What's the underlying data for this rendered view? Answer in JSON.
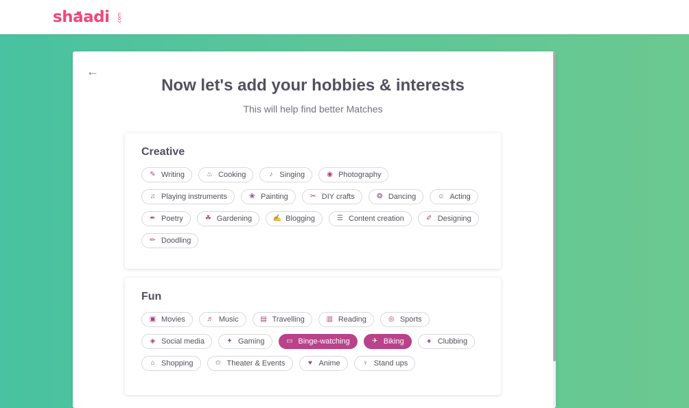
{
  "header": {
    "logo_text": "shaadi",
    "logo_suffix": ".com"
  },
  "page": {
    "title": "Now let's add your hobbies & interests",
    "subtitle": "This will help find better Matches"
  },
  "sections": [
    {
      "title": "Creative",
      "items": [
        {
          "label": "Writing",
          "icon": "writing-icon",
          "glyph": "✎",
          "selected": false
        },
        {
          "label": "Cooking",
          "icon": "cooking-icon",
          "glyph": "♨",
          "selected": false
        },
        {
          "label": "Singing",
          "icon": "singing-icon",
          "glyph": "♪",
          "selected": false
        },
        {
          "label": "Photography",
          "icon": "camera-icon",
          "glyph": "◉",
          "selected": false
        },
        {
          "label": "Playing instruments",
          "icon": "guitar-icon",
          "glyph": "♫",
          "selected": false
        },
        {
          "label": "Painting",
          "icon": "palette-icon",
          "glyph": "❀",
          "selected": false
        },
        {
          "label": "DIY crafts",
          "icon": "scissors-icon",
          "glyph": "✂",
          "selected": false
        },
        {
          "label": "Dancing",
          "icon": "dancing-icon",
          "glyph": "❂",
          "selected": false
        },
        {
          "label": "Acting",
          "icon": "masks-icon",
          "glyph": "☺",
          "selected": false
        },
        {
          "label": "Poetry",
          "icon": "quill-icon",
          "glyph": "✒",
          "selected": false
        },
        {
          "label": "Gardening",
          "icon": "gardening-icon",
          "glyph": "☘",
          "selected": false
        },
        {
          "label": "Blogging",
          "icon": "blogging-icon",
          "glyph": "✍",
          "selected": false
        },
        {
          "label": "Content creation",
          "icon": "document-icon",
          "glyph": "☰",
          "selected": false
        },
        {
          "label": "Designing",
          "icon": "designing-icon",
          "glyph": "✐",
          "selected": false
        },
        {
          "label": "Doodling",
          "icon": "pencil-icon",
          "glyph": "✏",
          "selected": false
        }
      ]
    },
    {
      "title": "Fun",
      "items": [
        {
          "label": "Movies",
          "icon": "movie-camera-icon",
          "glyph": "▣",
          "selected": false
        },
        {
          "label": "Music",
          "icon": "music-icon",
          "glyph": "♬",
          "selected": false
        },
        {
          "label": "Travelling",
          "icon": "luggage-icon",
          "glyph": "▤",
          "selected": false
        },
        {
          "label": "Reading",
          "icon": "book-icon",
          "glyph": "▥",
          "selected": false
        },
        {
          "label": "Sports",
          "icon": "ball-icon",
          "glyph": "◎",
          "selected": false
        },
        {
          "label": "Social media",
          "icon": "social-icon",
          "glyph": "◈",
          "selected": false
        },
        {
          "label": "Gaming",
          "icon": "gamepad-icon",
          "glyph": "✦",
          "selected": false
        },
        {
          "label": "Binge-watching",
          "icon": "laptop-icon",
          "glyph": "▭",
          "selected": true
        },
        {
          "label": "Biking",
          "icon": "bike-icon",
          "glyph": "✈",
          "selected": true
        },
        {
          "label": "Clubbing",
          "icon": "clubbing-icon",
          "glyph": "♠",
          "selected": false
        },
        {
          "label": "Shopping",
          "icon": "cart-icon",
          "glyph": "⌂",
          "selected": false
        },
        {
          "label": "Theater & Events",
          "icon": "theater-icon",
          "glyph": "✩",
          "selected": false
        },
        {
          "label": "Anime",
          "icon": "anime-icon",
          "glyph": "♥",
          "selected": false
        },
        {
          "label": "Stand ups",
          "icon": "microphone-icon",
          "glyph": "♀",
          "selected": false
        }
      ]
    }
  ],
  "colors": {
    "accent": "#b9428a",
    "brand": "#f0487a",
    "bg_start": "#48c2a0",
    "bg_end": "#6bc98f"
  }
}
